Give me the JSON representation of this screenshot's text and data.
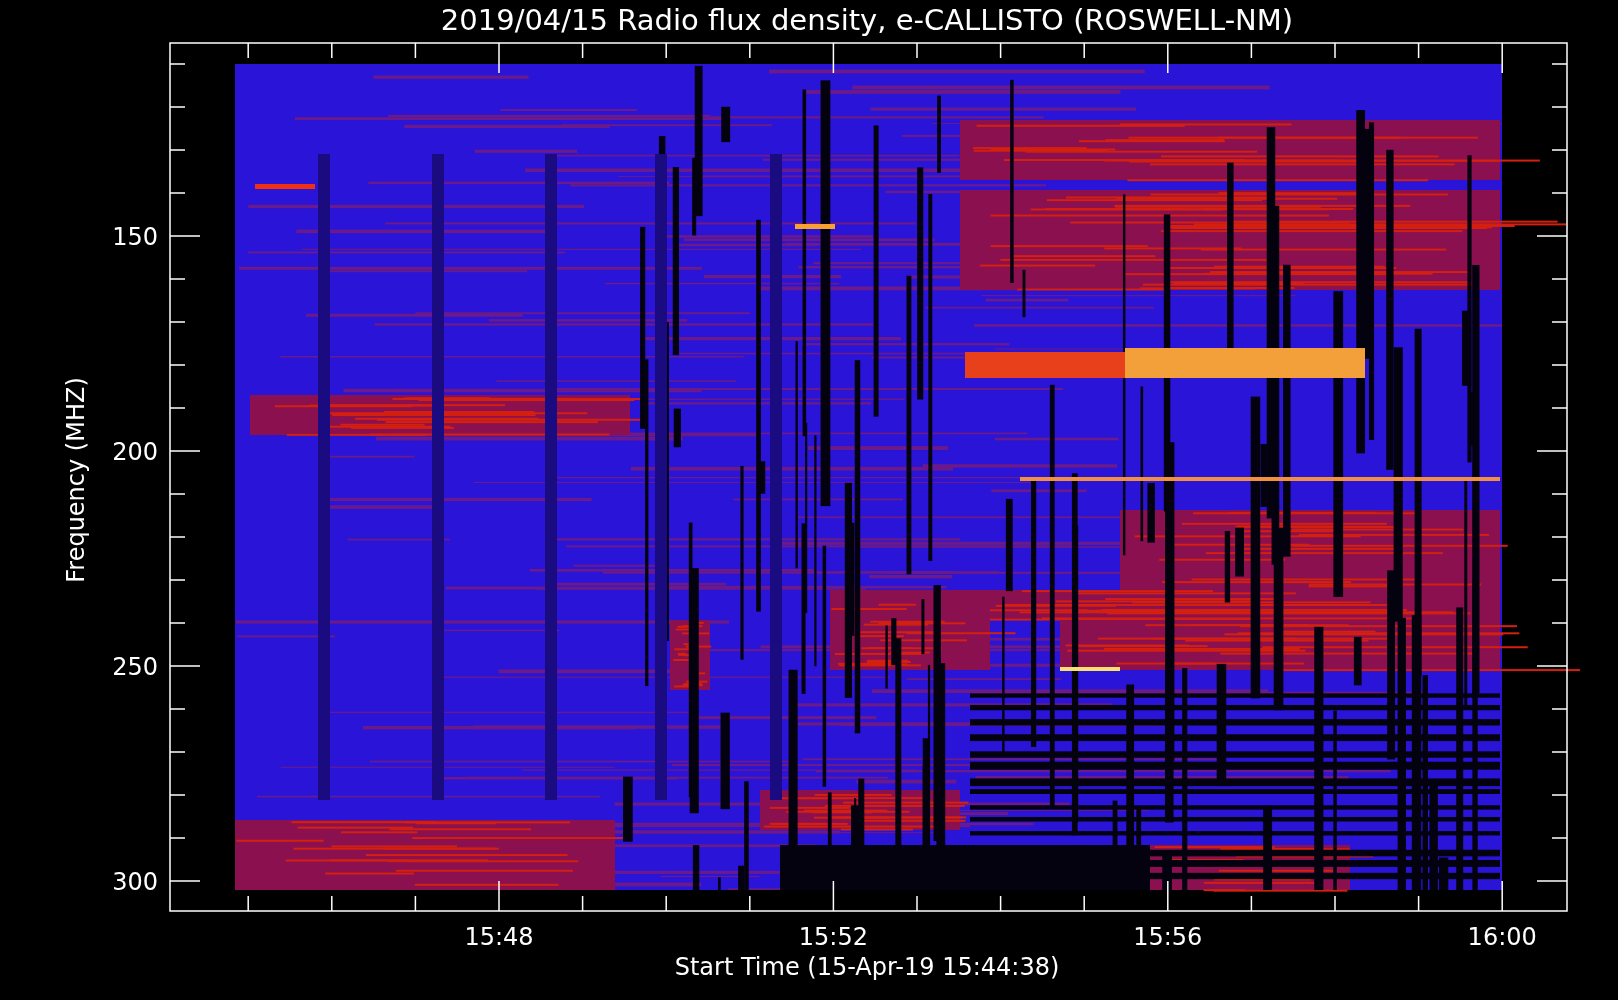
{
  "plot": {
    "title": "2019/04/15  Radio flux density, e-CALLISTO (ROSWELL-NM)",
    "ylabel": "Frequency (MHZ)",
    "xlabel": "Start Time (15-Apr-19 15:44:38)",
    "yticks": [
      "150",
      "200",
      "250",
      "300"
    ],
    "xticks": [
      "15:48",
      "15:52",
      "15:56",
      "16:00"
    ]
  }
}
